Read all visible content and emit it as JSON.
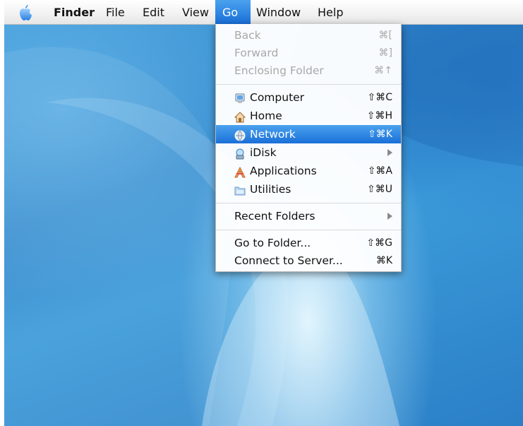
{
  "menubar": {
    "apple_icon": "apple-logo-icon",
    "items": [
      "Finder",
      "File",
      "Edit",
      "View",
      "Go",
      "Window",
      "Help"
    ],
    "selected": "Go"
  },
  "go_menu": {
    "back": {
      "label": "Back",
      "shortcut": "⌘[",
      "enabled": false
    },
    "forward": {
      "label": "Forward",
      "shortcut": "⌘]",
      "enabled": false
    },
    "enclosing": {
      "label": "Enclosing Folder",
      "shortcut": "⌘↑",
      "enabled": false
    },
    "computer": {
      "label": "Computer",
      "shortcut": "⇧⌘C",
      "icon": "computer-icon"
    },
    "home": {
      "label": "Home",
      "shortcut": "⇧⌘H",
      "icon": "home-icon"
    },
    "network": {
      "label": "Network",
      "shortcut": "⇧⌘K",
      "icon": "network-globe-icon",
      "highlighted": true
    },
    "idisk": {
      "label": "iDisk",
      "icon": "idisk-icon"
    },
    "applications": {
      "label": "Applications",
      "shortcut": "⇧⌘A",
      "icon": "applications-icon"
    },
    "utilities": {
      "label": "Utilities",
      "shortcut": "⇧⌘U",
      "icon": "utilities-folder-icon"
    },
    "recent": {
      "label": "Recent Folders"
    },
    "goto": {
      "label": "Go to Folder...",
      "shortcut": "⇧⌘G"
    },
    "connect": {
      "label": "Connect to Server...",
      "shortcut": "⌘K"
    }
  },
  "colors": {
    "highlight": "#2a7fe0",
    "desktop": "#3b94d6"
  }
}
